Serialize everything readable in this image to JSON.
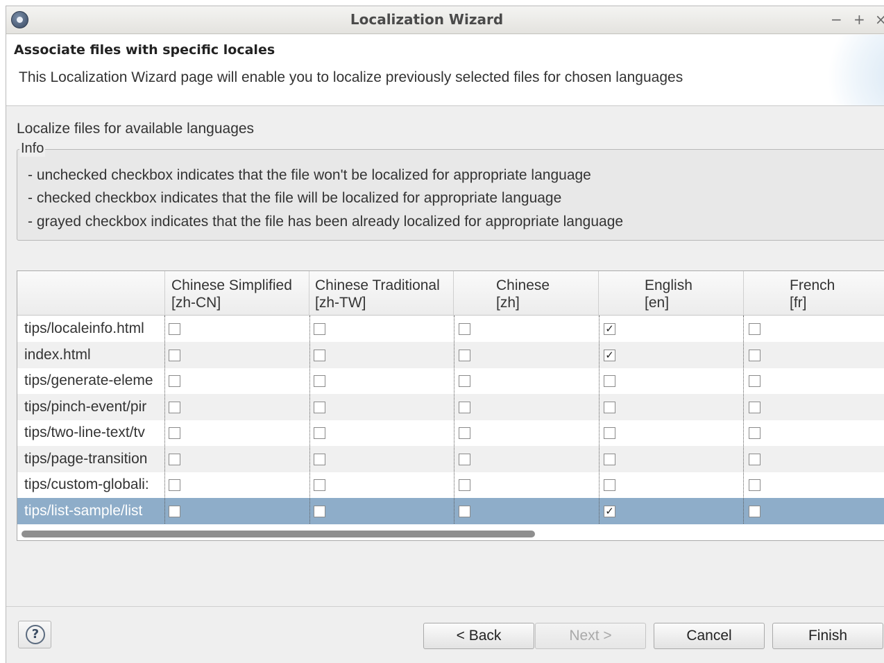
{
  "window": {
    "title": "Localization Wizard",
    "controls": {
      "minimize": "−",
      "maximize": "+",
      "close": "×"
    }
  },
  "header": {
    "title": "Associate files with specific locales",
    "description": "This Localization Wizard page will enable you to localize previously selected files for chosen languages"
  },
  "section_label": "Localize files for available languages",
  "info": {
    "legend": "Info",
    "lines": [
      "- unchecked checkbox indicates that the file won't be localized for appropriate language",
      "- checked checkbox indicates that the file will be localized for appropriate language",
      "- grayed checkbox indicates that the file has been already localized for appropriate language"
    ]
  },
  "table": {
    "columns": [
      {
        "name": "Chinese Simplified",
        "code": "[zh-CN]"
      },
      {
        "name": "Chinese Traditional",
        "code": "[zh-TW]"
      },
      {
        "name": "Chinese",
        "code": "[zh]"
      },
      {
        "name": "English",
        "code": "[en]"
      },
      {
        "name": "French",
        "code": "[fr]"
      }
    ],
    "rows": [
      {
        "file": "tips/localeinfo.html",
        "checks": [
          false,
          false,
          false,
          true,
          false
        ]
      },
      {
        "file": "index.html",
        "checks": [
          false,
          false,
          false,
          true,
          false
        ]
      },
      {
        "file": "tips/generate-eleme",
        "checks": [
          false,
          false,
          false,
          false,
          false
        ]
      },
      {
        "file": "tips/pinch-event/pir",
        "checks": [
          false,
          false,
          false,
          false,
          false
        ]
      },
      {
        "file": "tips/two-line-text/tv",
        "checks": [
          false,
          false,
          false,
          false,
          false
        ]
      },
      {
        "file": "tips/page-transition",
        "checks": [
          false,
          false,
          false,
          false,
          false
        ]
      },
      {
        "file": "tips/custom-globali:",
        "checks": [
          false,
          false,
          false,
          false,
          false
        ]
      },
      {
        "file": "tips/list-sample/list",
        "checks": [
          false,
          false,
          false,
          true,
          false
        ]
      }
    ],
    "selected_row": 7
  },
  "buttons": {
    "help": "?",
    "back": "< Back",
    "next": "Next >",
    "cancel": "Cancel",
    "finish": "Finish"
  },
  "colors": {
    "selection": "#8eadc9",
    "window_bg": "#efefef"
  }
}
